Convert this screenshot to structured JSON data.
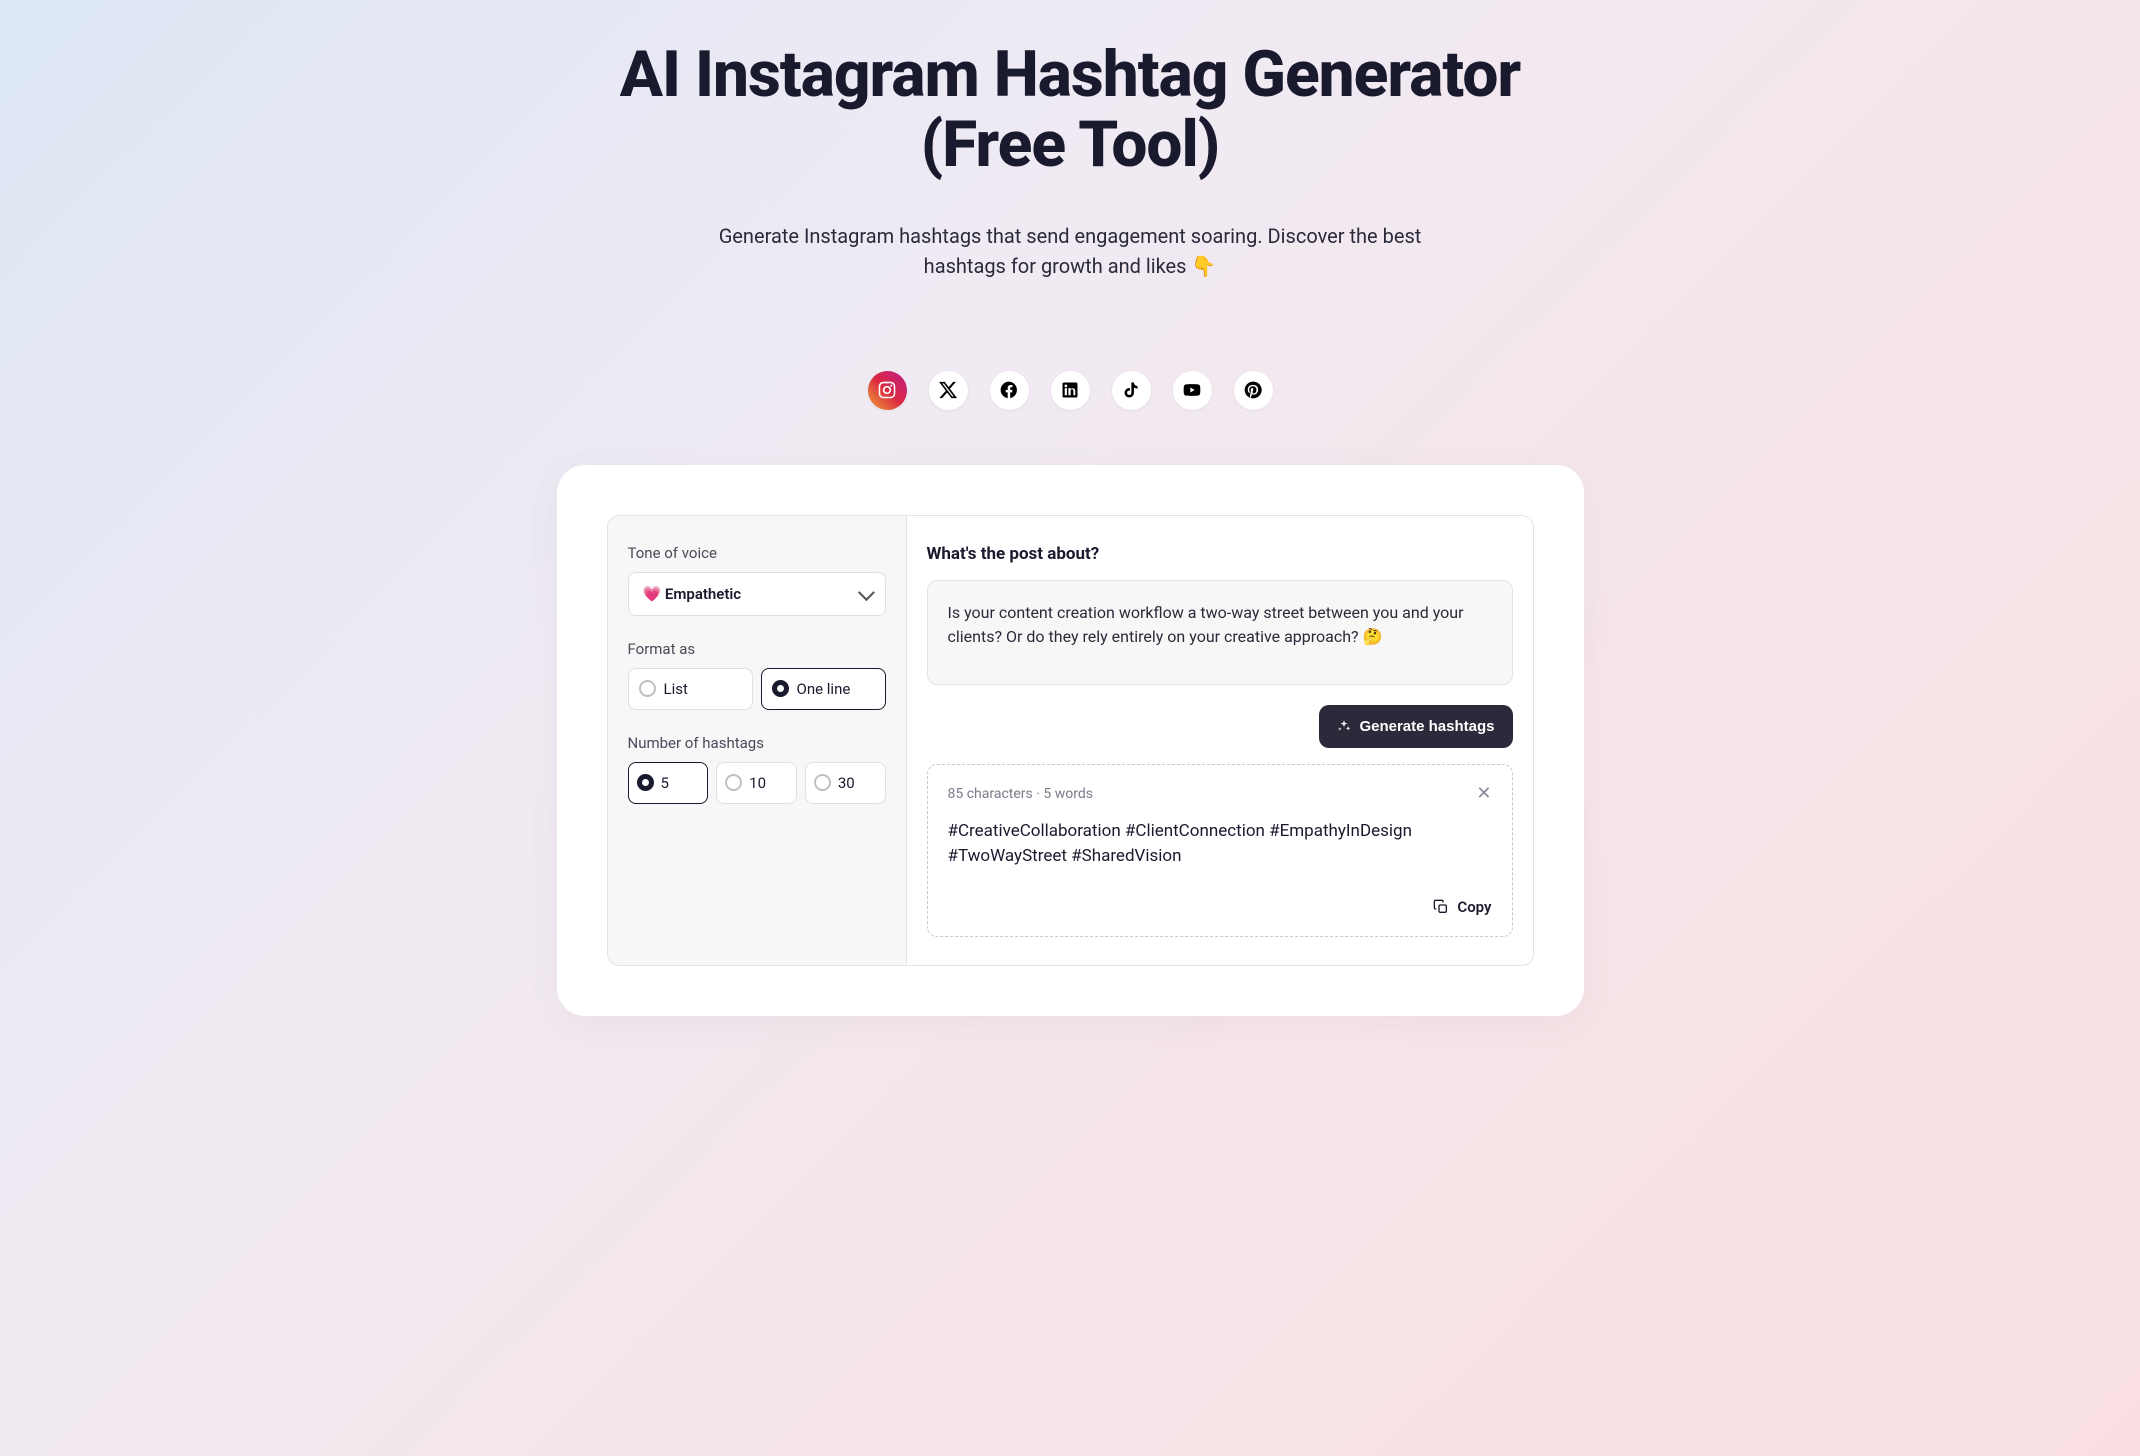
{
  "header": {
    "title": "AI Instagram Hashtag Generator (Free Tool)",
    "subtitle": "Generate Instagram hashtags that send engagement soaring. Discover the best hashtags for growth and likes 👇"
  },
  "social": {
    "items": [
      "instagram",
      "x",
      "facebook",
      "linkedin",
      "tiktok",
      "youtube",
      "pinterest"
    ],
    "active": "instagram"
  },
  "sidebar": {
    "tone_label": "Tone of voice",
    "tone_value": "💗 Empathetic",
    "format_label": "Format as",
    "format_options": [
      {
        "label": "List",
        "selected": false
      },
      {
        "label": "One line",
        "selected": true
      }
    ],
    "count_label": "Number of hashtags",
    "count_options": [
      {
        "label": "5",
        "selected": true
      },
      {
        "label": "10",
        "selected": false
      },
      {
        "label": "30",
        "selected": false
      }
    ]
  },
  "main": {
    "prompt_label": "What's the post about?",
    "prompt_value": "Is your content creation workflow a two-way street between you and your clients? Or do they rely entirely on your creative approach? 🤔",
    "generate_label": "Generate hashtags"
  },
  "result": {
    "meta": "85 characters · 5 words",
    "hashtags": "#CreativeCollaboration #ClientConnection #EmpathyInDesign #TwoWayStreet #SharedVision",
    "copy_label": "Copy"
  }
}
